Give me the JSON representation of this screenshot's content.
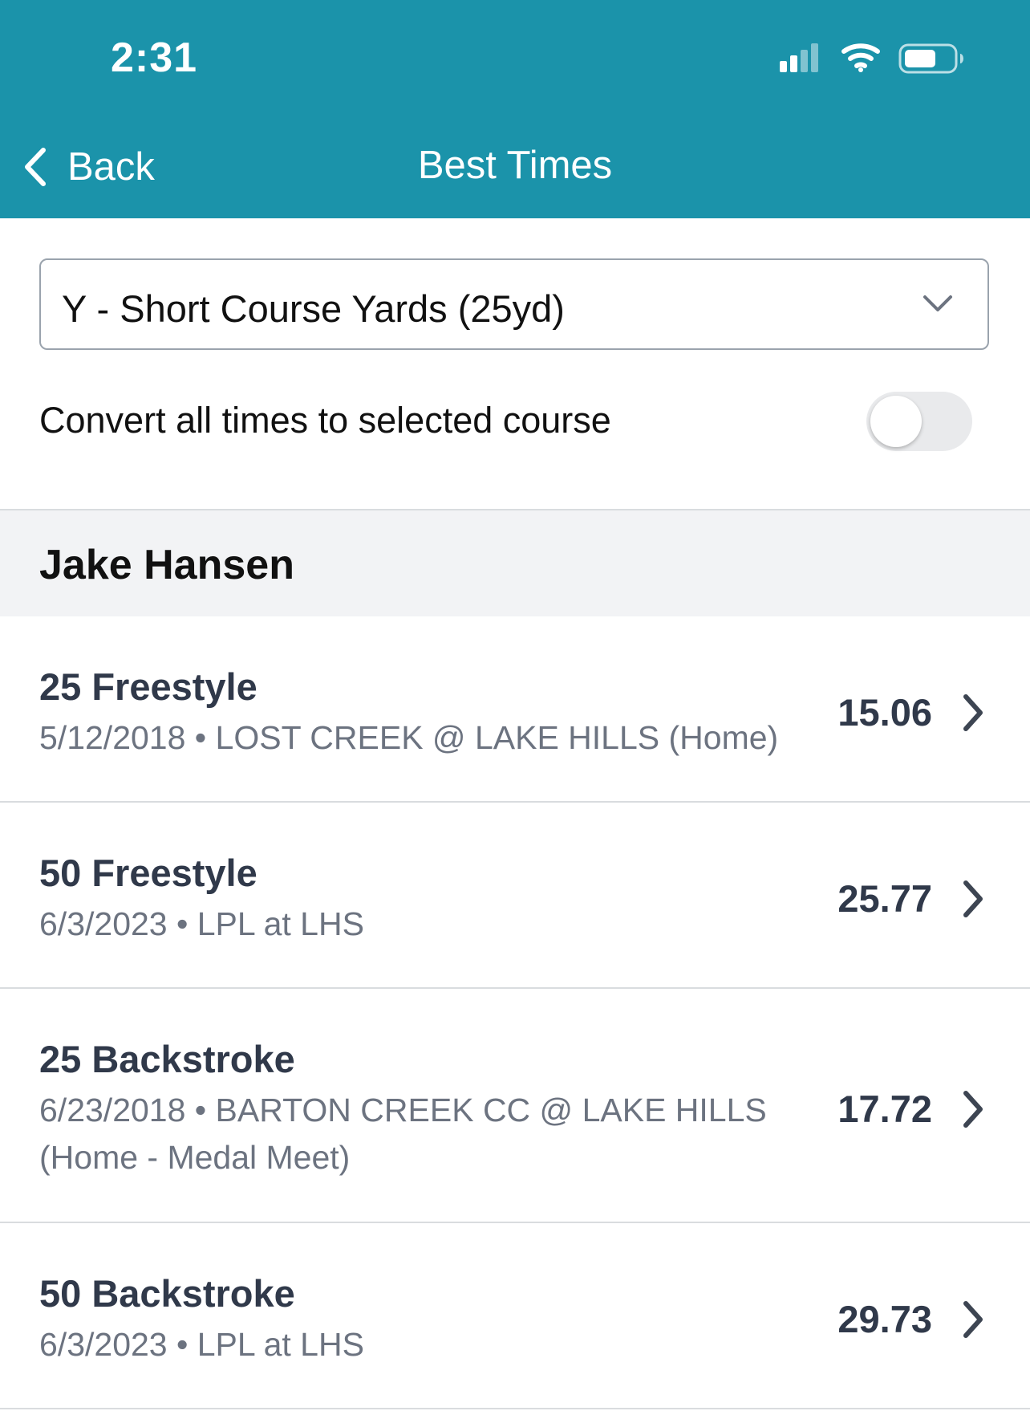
{
  "status_bar": {
    "time": "2:31",
    "icons": [
      "signal-icon",
      "wifi-icon",
      "battery-icon"
    ]
  },
  "nav": {
    "back_label": "Back",
    "title": "Best Times"
  },
  "course_select": {
    "value": "Y - Short Course Yards (25yd)"
  },
  "convert_toggle": {
    "label": "Convert all times to selected course",
    "on": false
  },
  "swimmer": {
    "name": "Jake Hansen"
  },
  "events": [
    {
      "name": "25 Freestyle",
      "date": "5/12/2018",
      "meet": "LOST CREEK @ LAKE HILLS (Home)",
      "time": "15.06"
    },
    {
      "name": "50 Freestyle",
      "date": "6/3/2023",
      "meet": "LPL at LHS",
      "time": "25.77"
    },
    {
      "name": "25 Backstroke",
      "date": "6/23/2018",
      "meet": "BARTON CREEK CC @ LAKE HILLS (Home - Medal Meet)",
      "time": "17.72"
    },
    {
      "name": "50 Backstroke",
      "date": "6/3/2023",
      "meet": "LPL at LHS",
      "time": "29.73"
    }
  ],
  "colors": {
    "header": "#1b93aa",
    "section_bg": "#f2f3f5",
    "primary_text": "#30394a",
    "secondary_text": "#6c7380"
  }
}
